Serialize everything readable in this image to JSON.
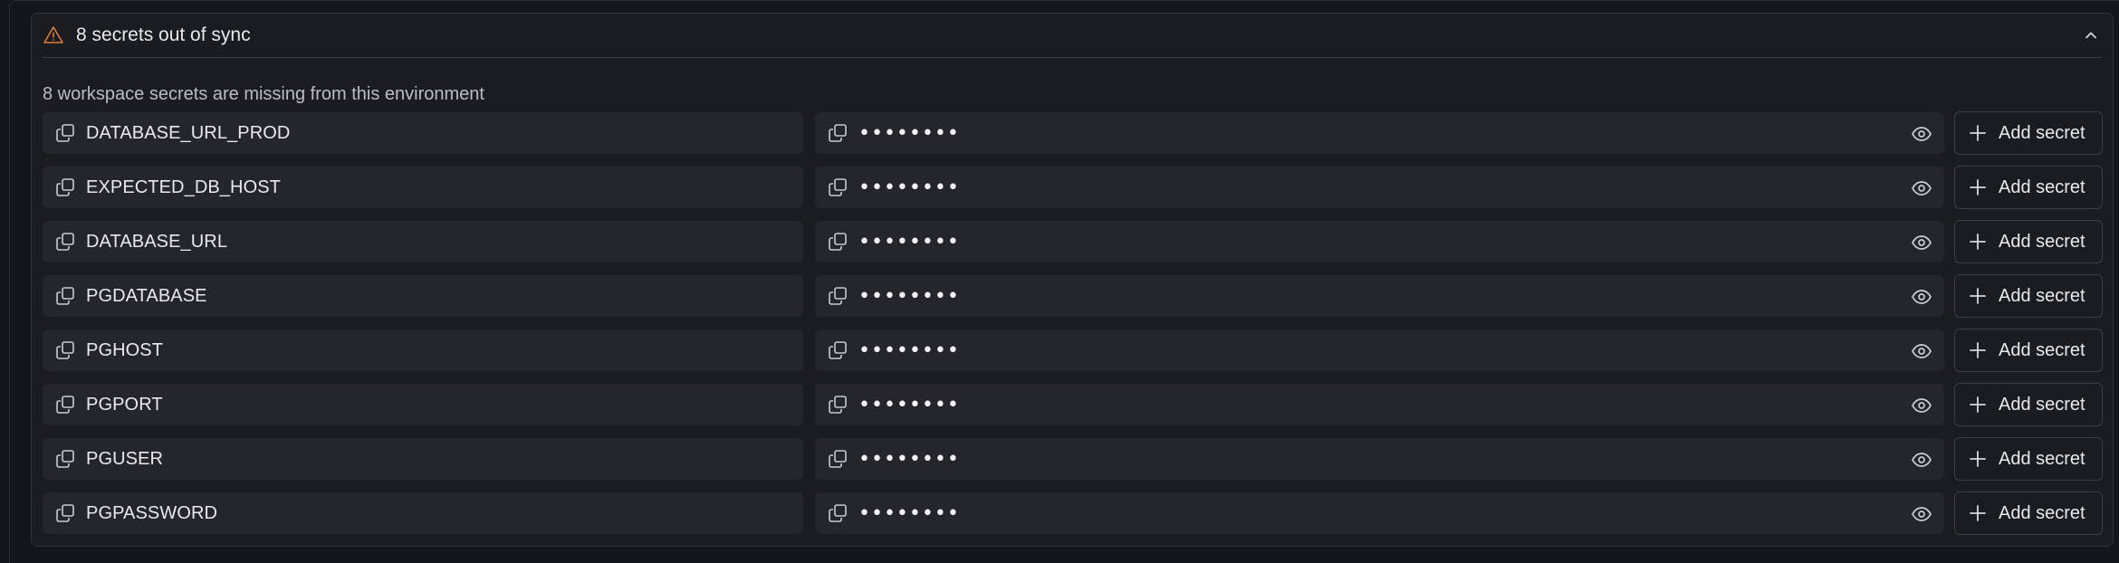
{
  "panel": {
    "title": "8 secrets out of sync",
    "subtitle": "8 workspace secrets are missing from this environment",
    "warning_color": "#e07b39",
    "icons": {
      "header": "warning-triangle-icon",
      "collapse": "chevron-up-icon",
      "copy": "copy-icon",
      "reveal": "eye-icon",
      "add": "plus-icon"
    }
  },
  "rows": [
    {
      "key": "DATABASE_URL_PROD",
      "value": "••••••••",
      "action": "Add secret"
    },
    {
      "key": "EXPECTED_DB_HOST",
      "value": "••••••••",
      "action": "Add secret"
    },
    {
      "key": "DATABASE_URL",
      "value": "••••••••",
      "action": "Add secret"
    },
    {
      "key": "PGDATABASE",
      "value": "••••••••",
      "action": "Add secret"
    },
    {
      "key": "PGHOST",
      "value": "••••••••",
      "action": "Add secret"
    },
    {
      "key": "PGPORT",
      "value": "••••••••",
      "action": "Add secret"
    },
    {
      "key": "PGUSER",
      "value": "••••••••",
      "action": "Add secret"
    },
    {
      "key": "PGPASSWORD",
      "value": "••••••••",
      "action": "Add secret"
    }
  ]
}
